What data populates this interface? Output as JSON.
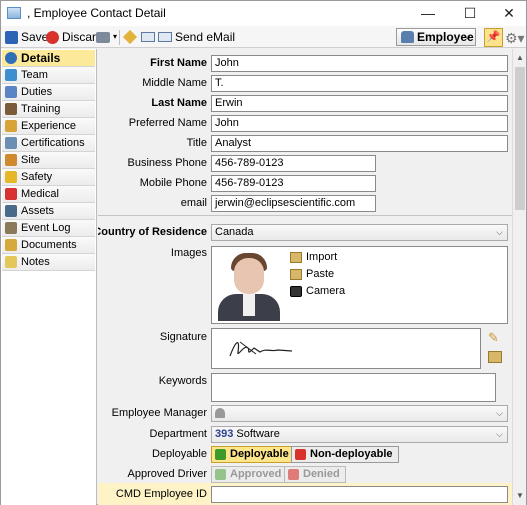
{
  "window": {
    "title": ",  Employee Contact Detail",
    "controls": {
      "minimize": "—",
      "maximize": "☐",
      "close": "✕"
    }
  },
  "toolbar": {
    "save": "Save",
    "discard": "Discard",
    "send_email": "Send eMail",
    "employee_dropdown": "Employee"
  },
  "sidebar": {
    "items": [
      {
        "label": "Details",
        "icon": "info-icon",
        "color": "#2f6fb8"
      },
      {
        "label": "Team",
        "icon": "team-icon",
        "color": "#3f8fd0"
      },
      {
        "label": "Duties",
        "icon": "duties-icon",
        "color": "#5b84c4"
      },
      {
        "label": "Training",
        "icon": "training-icon",
        "color": "#7a5c3a"
      },
      {
        "label": "Experience",
        "icon": "experience-icon",
        "color": "#d8a43a"
      },
      {
        "label": "Certifications",
        "icon": "certificate-icon",
        "color": "#6a8fb3"
      },
      {
        "label": "Site",
        "icon": "site-icon",
        "color": "#d08a2e"
      },
      {
        "label": "Safety",
        "icon": "safety-icon",
        "color": "#e7b72a"
      },
      {
        "label": "Medical",
        "icon": "medical-icon",
        "color": "#d83131"
      },
      {
        "label": "Assets",
        "icon": "assets-icon",
        "color": "#4a6a8a"
      },
      {
        "label": "Event Log",
        "icon": "event-log-icon",
        "color": "#8a7a5a"
      },
      {
        "label": "Documents",
        "icon": "documents-icon",
        "color": "#d6a93d"
      },
      {
        "label": "Notes",
        "icon": "notes-icon",
        "color": "#e3c75a"
      }
    ]
  },
  "form": {
    "first_name": {
      "label": "First Name",
      "value": "John"
    },
    "middle_name": {
      "label": "Middle Name",
      "value": "T."
    },
    "last_name": {
      "label": "Last Name",
      "value": "Erwin"
    },
    "preferred_name": {
      "label": "Preferred Name",
      "value": "John"
    },
    "title": {
      "label": "Title",
      "value": "Analyst"
    },
    "business_phone": {
      "label": "Business Phone",
      "value": "456-789-0123"
    },
    "mobile_phone": {
      "label": "Mobile Phone",
      "value": "456-789-0123"
    },
    "email": {
      "label": "email",
      "value": "jerwin@eclipsescientific.com"
    },
    "country": {
      "label": "Country of Residence",
      "value": "Canada"
    },
    "images": {
      "label": "Images",
      "import": "Import",
      "paste": "Paste",
      "camera": "Camera"
    },
    "signature": {
      "label": "Signature"
    },
    "keywords": {
      "label": "Keywords",
      "value": ""
    },
    "manager": {
      "label": "Employee Manager",
      "value": ""
    },
    "department": {
      "label": "Department",
      "code": "393",
      "name": "Software"
    },
    "deployable": {
      "label": "Deployable",
      "on": "Deployable",
      "off": "Non-deployable"
    },
    "approved_driver": {
      "label": "Approved Driver",
      "on": "Approved",
      "off": "Denied"
    },
    "cmd_employee_id": {
      "label": "CMD Employee ID",
      "value": ""
    }
  }
}
